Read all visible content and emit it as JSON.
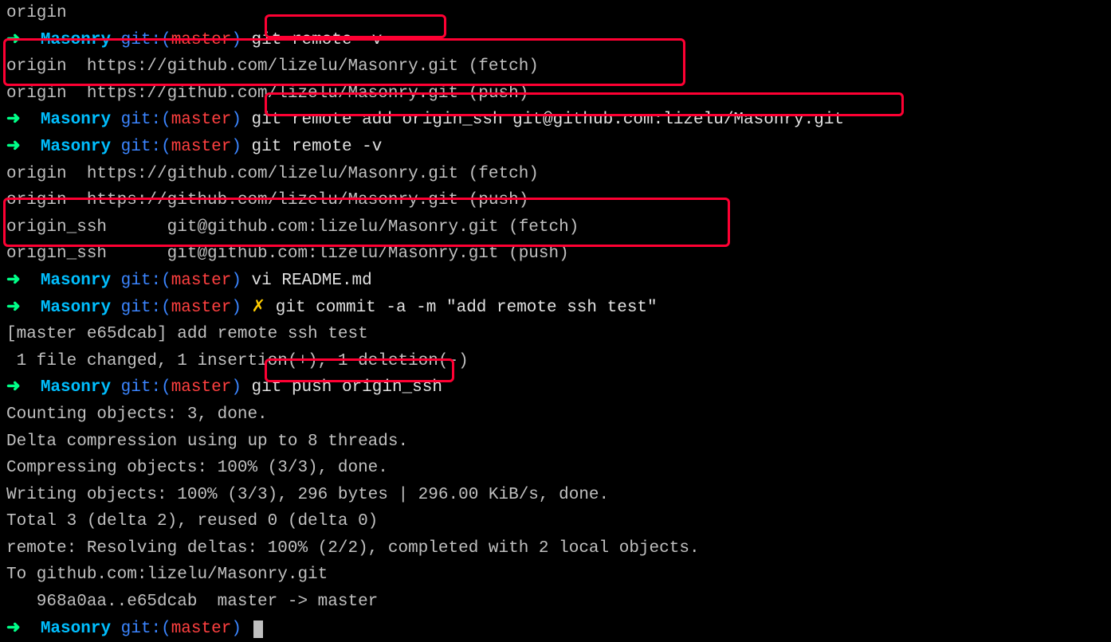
{
  "prompt": {
    "arrow": "➜",
    "dir": "Masonry",
    "git_label": "git:",
    "branch": "master",
    "dirty": "✗"
  },
  "lines": {
    "origin_top": "origin",
    "cmd1": "git remote -v",
    "out1a": "origin  https://github.com/lizelu/Masonry.git (fetch)",
    "out1b": "origin  https://github.com/lizelu/Masonry.git (push)",
    "cmd2": "git remote add origin_ssh git@github.com:lizelu/Masonry.git",
    "cmd3": "git remote -v",
    "out3a": "origin  https://github.com/lizelu/Masonry.git (fetch)",
    "out3b": "origin  https://github.com/lizelu/Masonry.git (push)",
    "out3c": "origin_ssh      git@github.com:lizelu/Masonry.git (fetch)",
    "out3d": "origin_ssh      git@github.com:lizelu/Masonry.git (push)",
    "cmd4": "vi README.md",
    "cmd5": "git commit -a -m \"add remote ssh test\"",
    "out5a": "[master e65dcab] add remote ssh test",
    "out5b": " 1 file changed, 1 insertion(+), 1 deletion(-)",
    "cmd6": "git push origin_ssh",
    "out6a": "Counting objects: 3, done.",
    "out6b": "Delta compression using up to 8 threads.",
    "out6c": "Compressing objects: 100% (3/3), done.",
    "out6d": "Writing objects: 100% (3/3), 296 bytes | 296.00 KiB/s, done.",
    "out6e": "Total 3 (delta 2), reused 0 (delta 0)",
    "out6f": "remote: Resolving deltas: 100% (2/2), completed with 2 local objects.",
    "out6g": "To github.com:lizelu/Masonry.git",
    "out6h": "   968a0aa..e65dcab  master -> master"
  }
}
